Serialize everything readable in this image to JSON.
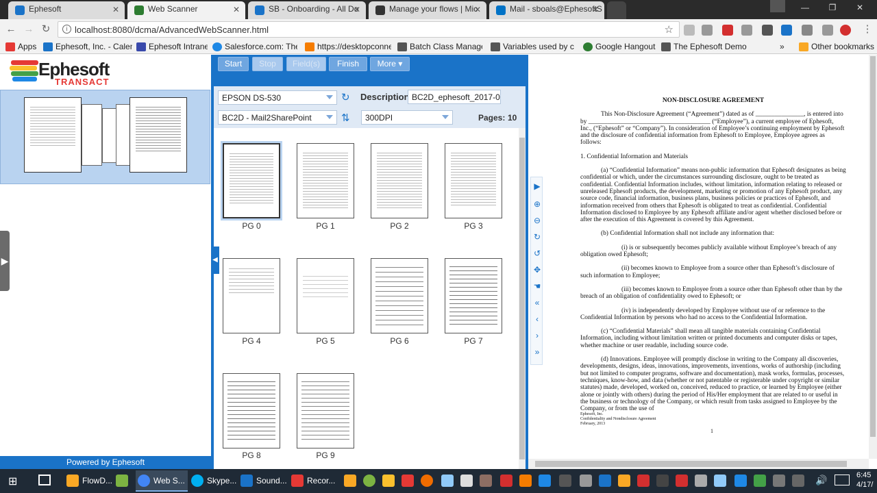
{
  "browser": {
    "tabs": [
      {
        "label": "Ephesoft",
        "color": "#1a73c8"
      },
      {
        "label": "Web Scanner",
        "color": "#2e7d32"
      },
      {
        "label": "SB - Onboarding - All Do",
        "color": "#1a73c8"
      },
      {
        "label": "Manage your flows | Mic",
        "color": "#333333"
      },
      {
        "label": "Mail - sboals@EphesoftS",
        "color": "#0072c6"
      }
    ],
    "url": "localhost:8080/dcma/AdvancedWebScanner.html",
    "bookmarks": [
      {
        "label": "Apps",
        "color": "#e53935"
      },
      {
        "label": "Ephesoft, Inc. - Calend",
        "color": "#1a73c8"
      },
      {
        "label": "Ephesoft Intranet",
        "color": "#3949ab"
      },
      {
        "label": "Salesforce.com: The C",
        "color": "#1e88e5"
      },
      {
        "label": "https://desktopconne",
        "color": "#f57c00"
      },
      {
        "label": "Batch Class Managem",
        "color": "#555555"
      },
      {
        "label": "Variables used by cop",
        "color": "#555555"
      },
      {
        "label": "Google Hangouts",
        "color": "#2e7d32"
      },
      {
        "label": "The Ephesoft Demo P",
        "color": "#555555"
      },
      {
        "label": "Other bookmarks",
        "color": "#f9a825"
      }
    ],
    "more_bookmarks": "»"
  },
  "app": {
    "logo_main": "Ephesoft",
    "logo_sub": "TRANSACT",
    "powered_by": "Powered by Ephesoft",
    "buttons": {
      "start": "Start",
      "stop": "Stop",
      "fields": "Field(s)",
      "finish": "Finish",
      "more": "More ▾"
    },
    "scanner": "EPSON DS-530",
    "description_label": "Description:",
    "description_value": "BC2D_ephesoft_2017-0",
    "batch_class": "BC2D - Mail2SharePoint",
    "resolution": "300DPI",
    "pages_label": "Pages:",
    "pages_value": "10",
    "thumbnails": [
      "PG 0",
      "PG 1",
      "PG 2",
      "PG 3",
      "PG 4",
      "PG 5",
      "PG 6",
      "PG 7",
      "PG 8",
      "PG 9"
    ]
  },
  "document": {
    "title": "NON-DISCLOSURE AGREEMENT",
    "p1": "This Non-Disclosure Agreement (“Agreement”) dated as of _______________, is entered into by ______________________________________ (“Employee”), a current employee of Ephesoft, Inc., (“Ephesoft” or “Company”). In consideration of Employee’s continuing employment by Ephesoft and the disclosure of confidential information from Ephesoft to Employee, Employee agrees as follows:",
    "s1": "1.      Confidential Information and Materials",
    "pa": "(a)      “Confidential Information” means non-public information that Ephesoft designates as being confidential or which, under the circumstances surrounding disclosure, ought to be treated as confidential. Confidential Information includes, without limitation, information relating to released or unreleased Ephesoft products, the development, marketing or promotion of any Ephesoft product, any source code, financial information, business plans, business policies or practices of Ephesoft, and information received from others that Ephesoft is obligated to treat as confidential. Confidential Information disclosed to Employee by any Ephesoft affiliate and/or agent whether disclosed before or after the execution of this Agreement is covered by this Agreement.",
    "pb": "(b)      Confidential Information shall not include any information that:",
    "pi": "(i)  is or subsequently becomes publicly available without Employee’s breach of any obligation owed Ephesoft;",
    "pii": "(ii)  becomes known to Employee from a source other than Ephesoft’s disclosure of such information to Employee;",
    "piii": "(iii)  becomes known to Employee from a source other than Ephesoft other than by the breach of an obligation of confidentiality owed to Ephesoft; or",
    "piv": "(iv)  is independently developed by Employee without use of or reference to the Confidential Information by persons who had no access to the Confidential Information.",
    "pc": "(c)      “Confidential Materials” shall mean all tangible materials containing Confidential Information, including without limitation written or printed documents and computer disks or tapes, whether machine or user readable, including source code.",
    "pd": "(d)  Innovations.  Employee will promptly disclose in writing to the Company all discoveries, developments, designs, ideas, innovations, improvements, inventions, works of authorship (including but not limited to computer programs, software and documentation), mask works, formulas, processes, techniques, know-how, and data (whether or not patentable or registerable under copyright or similar statutes) made, developed, worked on, conceived, reduced to practice, or learned by Employee (either alone or jointly with others) during the period of His/Her employment that are related to or useful in the business or technology of the Company, or which result from tasks assigned to Employee by the Company, or from the use of",
    "footer1": "Ephesoft, Inc.",
    "footer2": "Confidentiality and Nondisclosure Agreement",
    "footer3": "February, 2013",
    "page_num": "1"
  },
  "taskbar": {
    "items": [
      {
        "label": "FlowD...",
        "color": "#f9a825"
      },
      {
        "label": "",
        "color": "#7cb342"
      },
      {
        "label": "Web S...",
        "color": "#4285f4"
      },
      {
        "label": "Skype...",
        "color": "#00aff0"
      },
      {
        "label": "Sound...",
        "color": "#1a73c8"
      },
      {
        "label": "Recor...",
        "color": "#e53935"
      }
    ],
    "time": "6:45",
    "date": "4/17/"
  }
}
